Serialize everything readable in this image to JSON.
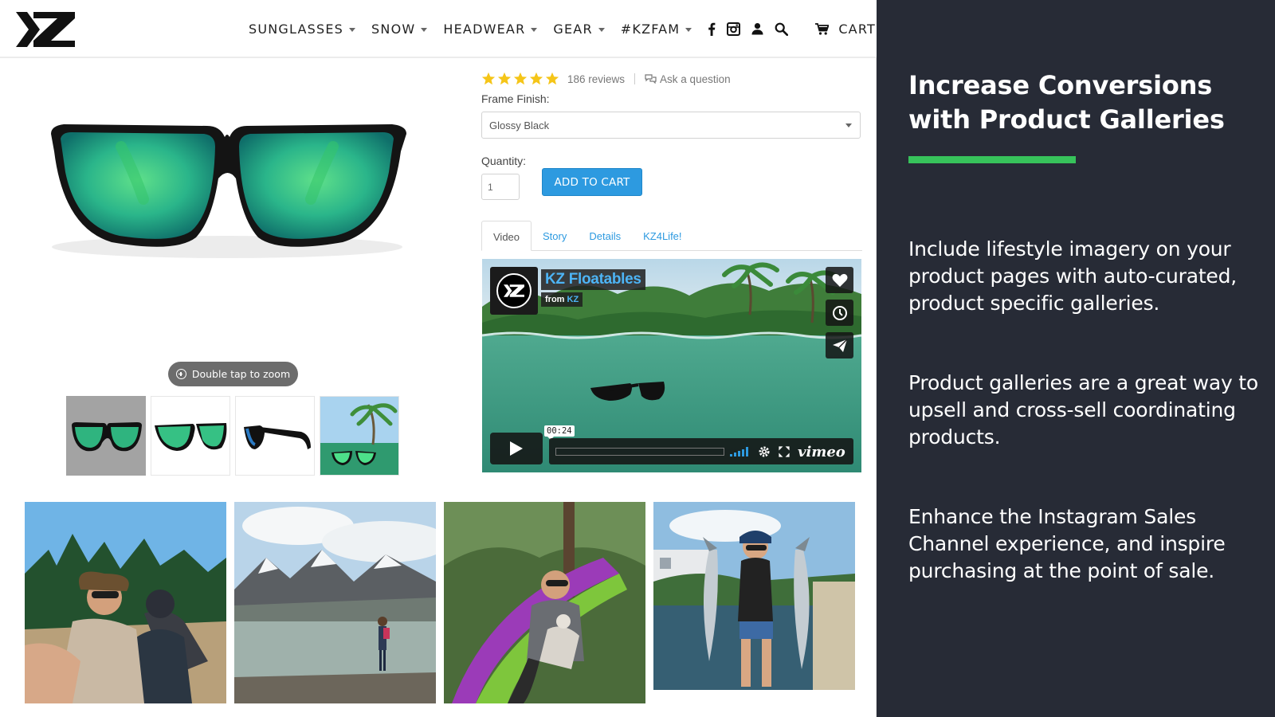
{
  "brand": {
    "logo_text": "KZ"
  },
  "nav": {
    "items": [
      {
        "label": "SUNGLASSES",
        "dropdown": true
      },
      {
        "label": "SNOW",
        "dropdown": true
      },
      {
        "label": "HEADWEAR",
        "dropdown": true
      },
      {
        "label": "GEAR",
        "dropdown": true
      },
      {
        "label": "#KZFAM",
        "dropdown": true
      }
    ],
    "icons": [
      "facebook-icon",
      "instagram-icon",
      "user-icon",
      "search-icon"
    ],
    "cart_label": "CART"
  },
  "product": {
    "zoom_hint": "Double tap to zoom",
    "thumbnails": [
      "front view",
      "angled view",
      "side view",
      "lifestyle view"
    ],
    "active_thumbnail": 0
  },
  "details": {
    "rating_stars": 5,
    "reviews": "186 reviews",
    "ask_question": "Ask a question",
    "frame_finish_label": "Frame Finish:",
    "frame_finish_value": "Glossy Black",
    "quantity_label": "Quantity:",
    "quantity_value": "1",
    "add_to_cart": "ADD TO CART",
    "tabs": [
      "Video",
      "Story",
      "Details",
      "KZ4Life!"
    ],
    "active_tab": "Video"
  },
  "video": {
    "title": "KZ Floatables",
    "from_prefix": "from",
    "from_channel": "KZ",
    "timecode": "00:24",
    "progress": 0.0,
    "provider": "vimeo",
    "side_buttons": [
      "like-icon",
      "watch-later-icon",
      "share-icon"
    ]
  },
  "gallery": {
    "images": [
      "atv riders selfie",
      "glacier lake hiker",
      "hammock with dog",
      "woman holding fish"
    ]
  },
  "panel": {
    "heading": "Increase Conversions with Product Galleries",
    "accent_color": "#37c35b",
    "background_color": "#272b36",
    "paragraphs": [
      "Include lifestyle imagery on your product pages with auto-curated, product specific galleries.",
      "Product galleries are a great way to upsell and cross-sell coordinating products.",
      "Enhance the Instagram Sales Channel experience, and inspire purchasing at the point of sale."
    ]
  },
  "colors": {
    "link_blue": "#2d9ae0",
    "star_yellow": "#f5c518"
  }
}
